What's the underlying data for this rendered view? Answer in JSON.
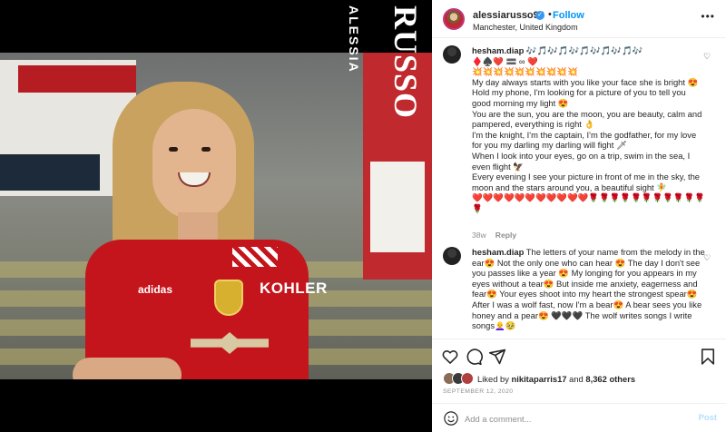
{
  "post": {
    "owner": {
      "username": "alessiarusso99",
      "location": "Manchester, United Kingdom",
      "follow_label": "Follow",
      "verified_icon": "verified-badge-icon"
    },
    "photo": {
      "overlay_name_small": "ALESSIA",
      "overlay_name_large": "RUSSO",
      "sponsor_text": "KOHLER",
      "brand_text": "adidas"
    },
    "more_icon": "more-options-icon"
  },
  "comments": [
    {
      "username": "hesham.diap",
      "text": " 🎶🎵🎶🎵🎶🎵🎶🎵🎶🎵🎶\n♦️♠️❤️ 🟰 ∞ ❤️\n💥💥💥💥💥💥💥💥💥💥\nMy day always starts with you like your face she is bright 😍\nHold my phone, I'm looking for a picture of you to tell you good morning my light 😍\nYou are the sun, you are the moon, you are beauty, calm and pampered, everything is right 👌\nI'm the knight, I'm the captain, I'm the godfather, for my love for you my darling my darling will fight 🗡\nWhen I look into your eyes, go on a trip, swim in the sea, I even flight 🦅\nEvery evening I see your picture in front of me in the sky, the moon and the stars around you, a beautiful sight 🧚\n❤️❤️❤️❤️❤️❤️❤️❤️❤️❤️❤️🌹🌹🌹🌹🌹🌹🌹🌹🌹🌹🌹🌹",
      "age": "38w",
      "reply_label": "Reply"
    },
    {
      "username": "hesham.diap",
      "text": " The letters of your name from the melody in the ear😍 Not the only one who can hear 😍 The day I don't see you passes like a year 😍 My longing for you appears in my eyes without a tear😍 But inside me anxiety, eagerness and fear😍 Your eyes shoot into my heart the strongest spear😍 After I was a wolf fast, now I'm a bear😍 A bear sees you like honey and a pear😍 🖤🖤🖤 The wolf writes songs I write songs👩‍🦲🥹"
    }
  ],
  "actions": {
    "like_icon": "heart-icon",
    "comment_icon": "comment-icon",
    "share_icon": "share-icon",
    "save_icon": "bookmark-icon"
  },
  "likes": {
    "prefix": "Liked by",
    "first_user": "nikitaparris17",
    "connector": "and",
    "others": "8,362 others"
  },
  "date": "SEPTEMBER 12, 2020",
  "add_comment": {
    "placeholder": "Add a comment...",
    "post_label": "Post",
    "emoji_icon": "emoji-icon"
  }
}
